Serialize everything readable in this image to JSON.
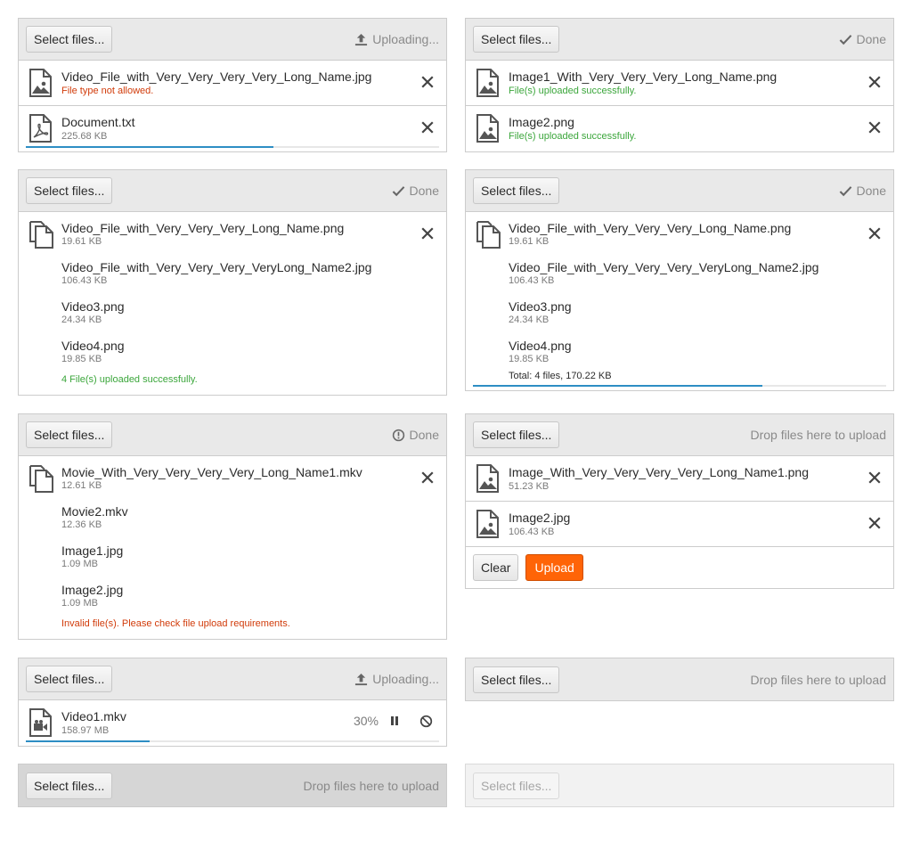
{
  "select_label": "Select files...",
  "panels": {
    "p1": {
      "status": "Uploading...",
      "files": [
        {
          "name": "Video_File_with_Very_Very_Very_Very_Long_Name.jpg",
          "sub": "File type not allowed.",
          "icon": "image-file-icon"
        },
        {
          "name": "Document.txt",
          "sub": "225.68 KB",
          "icon": "pdf-file-icon",
          "progress": 0.6
        }
      ]
    },
    "p2": {
      "status": "Done",
      "files": [
        {
          "name": "Image1_With_Very_Very_Very_Long_Name.png",
          "sub": "File(s) uploaded successfully.",
          "icon": "image-file-icon"
        },
        {
          "name": "Image2.png",
          "sub": "File(s) uploaded successfully.",
          "icon": "image-file-icon"
        }
      ]
    },
    "p3": {
      "status": "Done",
      "files": [
        {
          "name": "Video_File_with_Very_Very_Very_Long_Name.png",
          "sub": "19.61 KB"
        },
        {
          "name": "Video_File_with_Very_Very_Very_VeryLong_Name2.jpg",
          "sub": "106.43 KB"
        },
        {
          "name": "Video3.png",
          "sub": "24.34 KB"
        },
        {
          "name": "Video4.png",
          "sub": "19.85 KB"
        }
      ],
      "summary": "4 File(s) uploaded successfully."
    },
    "p4": {
      "status": "Done",
      "files": [
        {
          "name": "Video_File_with_Very_Very_Very_Long_Name.png",
          "sub": "19.61 KB"
        },
        {
          "name": "Video_File_with_Very_Very_Very_VeryLong_Name2.jpg",
          "sub": "106.43 KB"
        },
        {
          "name": "Video3.png",
          "sub": "24.34 KB"
        },
        {
          "name": "Video4.png",
          "sub": "19.85 KB"
        }
      ],
      "summary": "Total: 4 files, 170.22 KB",
      "progress": 0.7
    },
    "p5": {
      "status": "Done",
      "files": [
        {
          "name": "Movie_With_Very_Very_Very_Very_Long_Name1.mkv",
          "sub": "12.61 KB"
        },
        {
          "name": "Movie2.mkv",
          "sub": "12.36 KB"
        },
        {
          "name": "Image1.jpg",
          "sub": "1.09 MB"
        },
        {
          "name": "Image2.jpg",
          "sub": "1.09 MB"
        }
      ],
      "summary": "Invalid file(s). Please check file upload requirements."
    },
    "p6": {
      "status": "Drop files here to upload",
      "files": [
        {
          "name": "Image_With_Very_Very_Very_Very_Long_Name1.png",
          "sub": "51.23 KB",
          "icon": "image-file-icon"
        },
        {
          "name": "Image2.jpg",
          "sub": "106.43 KB",
          "icon": "image-file-icon"
        }
      ],
      "clear_label": "Clear",
      "upload_label": "Upload"
    },
    "p7": {
      "status": "Uploading...",
      "files": [
        {
          "name": "Video1.mkv",
          "sub": "158.97 MB",
          "icon": "video-file-icon",
          "percent": "30%",
          "progress": 0.3
        }
      ]
    },
    "p8": {
      "status": "Drop files here to upload"
    },
    "p9": {
      "status": "Drop files here to upload"
    },
    "p10": {
      "status": ""
    }
  },
  "colors": {
    "accent": "#2e8ec4",
    "error": "#d13b0a",
    "success": "#3ba63b",
    "primary": "#ff6407"
  }
}
